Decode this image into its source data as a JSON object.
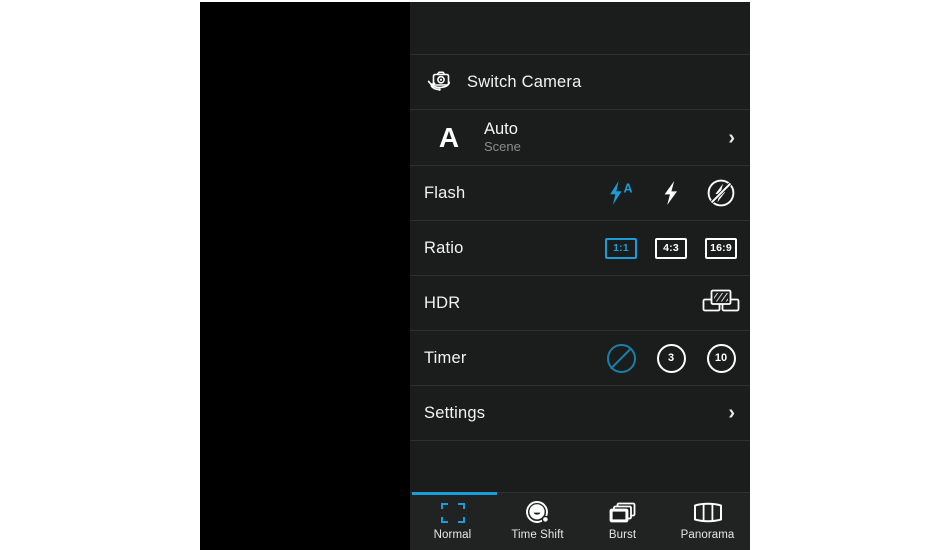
{
  "colors": {
    "accent": "#1a9cd8",
    "accent_dim": "#1a7fa8",
    "panel_bg": "#1b1c1c",
    "tabbar_bg": "#212222",
    "viewfinder_bg": "#000000",
    "divider": "#2e2f2f",
    "text_primary": "#f2f2f2",
    "text_secondary": "#8c8c8c"
  },
  "panel": {
    "switch_camera": {
      "label": "Switch Camera",
      "icon": "switch-camera-icon"
    },
    "scene": {
      "badge": "A",
      "title": "Auto",
      "subtitle": "Scene",
      "chevron": "›"
    },
    "flash": {
      "label": "Flash",
      "options": [
        {
          "name": "flash-auto-icon",
          "selected": true
        },
        {
          "name": "flash-on-icon",
          "selected": false
        },
        {
          "name": "flash-off-icon",
          "selected": false
        }
      ]
    },
    "ratio": {
      "label": "Ratio",
      "options": [
        {
          "value": "1:1",
          "selected": true
        },
        {
          "value": "4:3",
          "selected": false
        },
        {
          "value": "16:9",
          "selected": false
        }
      ]
    },
    "hdr": {
      "label": "HDR",
      "icon": "hdr-stacked-photos-icon"
    },
    "timer": {
      "label": "Timer",
      "options": [
        {
          "value": "",
          "name": "timer-off-icon",
          "selected": true
        },
        {
          "value": "3",
          "name": "timer-3-icon",
          "selected": false
        },
        {
          "value": "10",
          "name": "timer-10-icon",
          "selected": false
        }
      ]
    },
    "settings": {
      "label": "Settings",
      "chevron": "›"
    }
  },
  "tabbar": {
    "tabs": [
      {
        "label": "Normal",
        "icon": "normal-brackets-icon",
        "active": true
      },
      {
        "label": "Time Shift",
        "icon": "time-shift-icon",
        "active": false
      },
      {
        "label": "Burst",
        "icon": "burst-icon",
        "active": false
      },
      {
        "label": "Panorama",
        "icon": "panorama-icon",
        "active": false
      }
    ]
  }
}
